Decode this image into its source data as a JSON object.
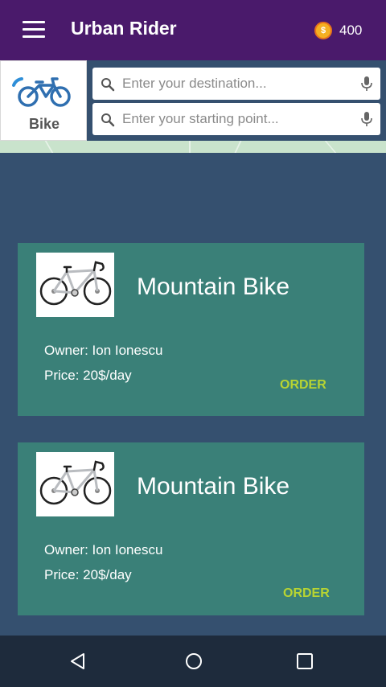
{
  "header": {
    "title": "Urban Rider",
    "coins": "400",
    "coin_symbol": "$"
  },
  "vehicle": {
    "label": "Bike"
  },
  "search": {
    "destination_placeholder": "Enter your destination...",
    "start_placeholder": "Enter your starting point..."
  },
  "listings": [
    {
      "title": "Mountain Bike",
      "owner": "Owner: Ion Ionescu",
      "price": "Price: 20$/day",
      "action": "ORDER"
    },
    {
      "title": "Mountain Bike",
      "owner": "Owner: Ion Ionescu",
      "price": "Price: 20$/day",
      "action": "ORDER"
    }
  ],
  "colors": {
    "topbar": "#4a1a6b",
    "background": "#35506f",
    "card": "#3a8078",
    "order_accent": "#b8d432",
    "navbar": "#1e2b3c"
  },
  "icons": [
    "menu-icon",
    "coin-icon",
    "bike-icon",
    "search-icon",
    "mic-icon",
    "back-icon",
    "home-icon",
    "recents-icon"
  ]
}
